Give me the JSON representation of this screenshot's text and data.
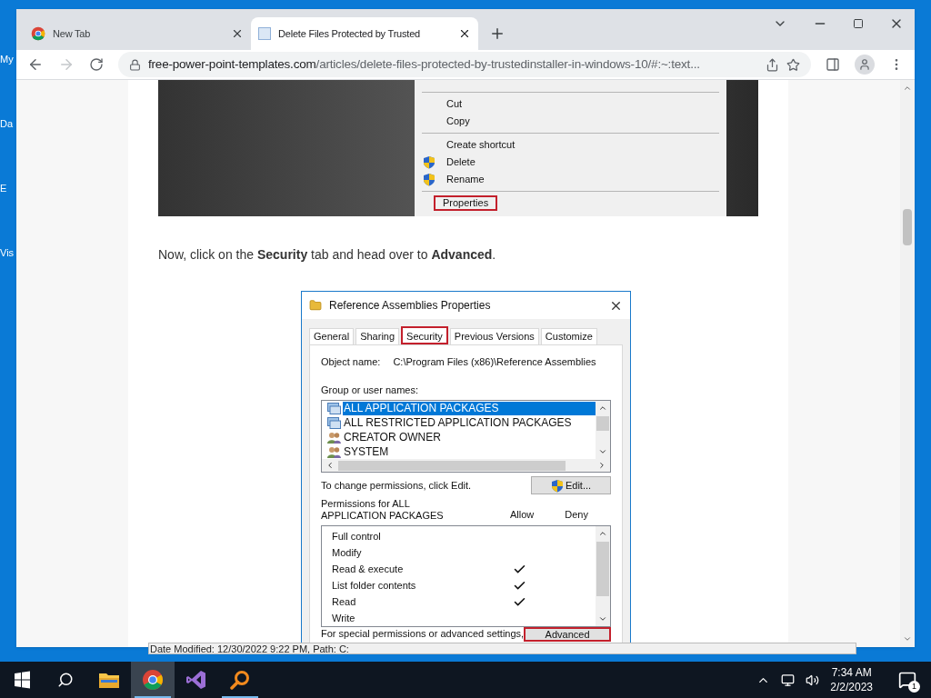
{
  "desktop_labels": [
    "My",
    "Da",
    "E",
    "Vis"
  ],
  "browser": {
    "tabs": [
      {
        "title": "New Tab",
        "kind": "chrome",
        "selected": false
      },
      {
        "title": "Delete Files Protected by Trusted",
        "kind": "page",
        "selected": true
      }
    ],
    "url_domain": "free-power-point-templates.com",
    "url_path": "/articles/delete-files-protected-by-trustedinstaller-in-windows-10/#:~:text...",
    "forward_disabled": true
  },
  "article": {
    "context_menu": [
      {
        "label": "Cut",
        "shield": false,
        "separator_before": true,
        "outlined": false
      },
      {
        "label": "Copy",
        "shield": false,
        "separator_before": false,
        "outlined": false
      },
      {
        "label": "Create shortcut",
        "shield": false,
        "separator_before": true,
        "outlined": false
      },
      {
        "label": "Delete",
        "shield": true,
        "separator_before": false,
        "outlined": false
      },
      {
        "label": "Rename",
        "shield": true,
        "separator_before": false,
        "outlined": false
      },
      {
        "label": "Properties",
        "shield": false,
        "separator_before": true,
        "outlined": true
      }
    ],
    "paragraph": "Now, click on the **Security** tab and head over to **Advanced**.",
    "dialog": {
      "title": "Reference Assemblies Properties",
      "tabs": [
        {
          "label": "General",
          "selected": false,
          "outlined": false
        },
        {
          "label": "Sharing",
          "selected": false,
          "outlined": false
        },
        {
          "label": "Security",
          "selected": true,
          "outlined": true
        },
        {
          "label": "Previous Versions",
          "selected": false,
          "outlined": false
        },
        {
          "label": "Customize",
          "selected": false,
          "outlined": false
        }
      ],
      "object_label": "Object name:",
      "object_value": "C:\\Program Files (x86)\\Reference Assemblies",
      "group_label": "Group or user names:",
      "groups": [
        {
          "name": "ALL APPLICATION PACKAGES",
          "kind": "package",
          "selected": true
        },
        {
          "name": "ALL RESTRICTED APPLICATION PACKAGES",
          "kind": "package",
          "selected": false
        },
        {
          "name": "CREATOR OWNER",
          "kind": "user",
          "selected": false
        },
        {
          "name": "SYSTEM",
          "kind": "user",
          "selected": false
        }
      ],
      "change_hint": "To change permissions, click Edit.",
      "edit_button": "Edit...",
      "permissions_label": "Permissions for ALL APPLICATION PACKAGES",
      "allow_label": "Allow",
      "deny_label": "Deny",
      "permissions": [
        {
          "name": "Full control",
          "allow": false,
          "deny": false
        },
        {
          "name": "Modify",
          "allow": false,
          "deny": false
        },
        {
          "name": "Read & execute",
          "allow": true,
          "deny": false
        },
        {
          "name": "List folder contents",
          "allow": true,
          "deny": false
        },
        {
          "name": "Read",
          "allow": true,
          "deny": false
        },
        {
          "name": "Write",
          "allow": false,
          "deny": false
        }
      ],
      "advanced_hint": "For special permissions or advanced settings,",
      "advanced_button": {
        "label": "Advanced",
        "outlined": true
      }
    }
  },
  "status_strip": "Date Modified: 12/30/2022 9:22 PM, Path: C:",
  "taskbar": {
    "apps": [
      {
        "kind": "folder",
        "selected": false,
        "running": false
      },
      {
        "kind": "chrome",
        "selected": true,
        "running": true
      },
      {
        "kind": "studio",
        "selected": false,
        "running": false
      },
      {
        "kind": "magnifier",
        "selected": false,
        "running": true
      }
    ],
    "time": "7:34 AM",
    "date": "2/2/2023",
    "notifications": "1"
  }
}
